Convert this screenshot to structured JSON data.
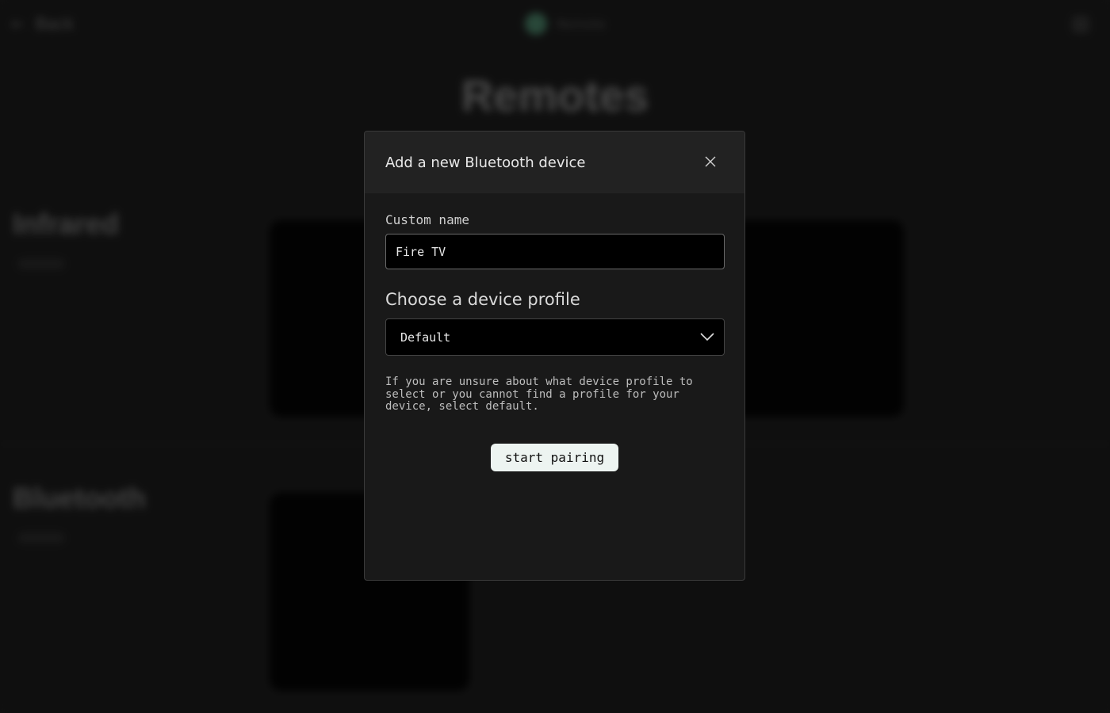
{
  "background": {
    "nav": {
      "back_label": "Back",
      "brand_name": "Remote"
    },
    "page_title": "Remotes",
    "sections": [
      {
        "title": "Infrared"
      },
      {
        "title": "Bluetooth"
      }
    ]
  },
  "modal": {
    "title": "Add a new Bluetooth device",
    "close_icon": "close-icon",
    "custom_name": {
      "label": "Custom name",
      "value": "Fire TV"
    },
    "profile": {
      "heading": "Choose a device profile",
      "selected": "Default",
      "icon": "chevron-down-icon"
    },
    "help_text": "If you are unsure about what device profile to select or you cannot find a profile for your device, select default.",
    "primary_button": "start pairing"
  },
  "colors": {
    "background": "#181818",
    "modal_header": "#222222",
    "modal_body": "#191919",
    "input_bg": "#000000",
    "button_bg": "#edf4f1"
  }
}
